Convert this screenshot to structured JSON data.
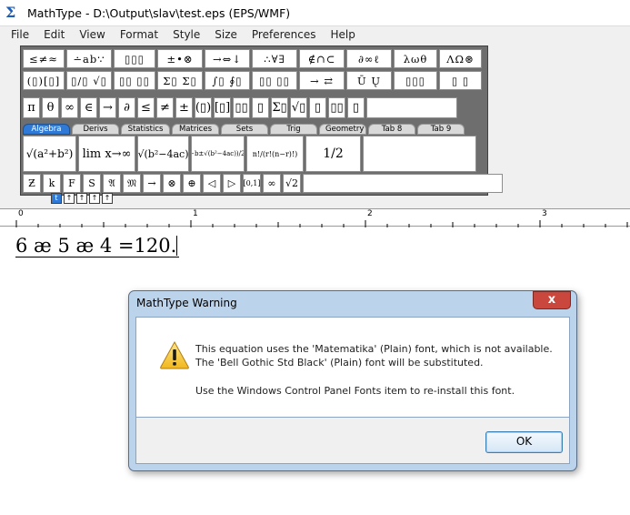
{
  "window": {
    "title": "MathType - D:\\Output\\slav\\test.eps (EPS/WMF)"
  },
  "menu": [
    "File",
    "Edit",
    "View",
    "Format",
    "Style",
    "Size",
    "Preferences",
    "Help"
  ],
  "palette": {
    "row1": [
      "≤≠≈",
      "∸ab∵",
      "▯▯▯",
      "±•⊗",
      "→⇔↓",
      "∴∀∃",
      "∉∩⊂",
      "∂∞ℓ",
      "λωθ",
      "ΛΩ⊛"
    ],
    "row2": [
      "(▯)[▯]",
      "▯/▯ √▯",
      "▯▯ ▯▯",
      "Σ▯ Σ▯",
      "∫▯ ∮▯",
      "▯▯ ▯▯",
      "→ ⇄",
      "Ū Ų",
      "▯▯▯",
      "▯ ▯"
    ],
    "row3": [
      "π",
      "θ",
      "∞",
      "∈",
      "→",
      "∂",
      "≤",
      "≠",
      "±",
      "(▯)",
      "[▯]",
      "▯▯",
      "▯",
      "Σ▯",
      "√▯",
      "▯",
      "▯▯",
      "▯"
    ],
    "tabs": [
      "Algebra",
      "Derivs",
      "Statistics",
      "Matrices",
      "Sets",
      "Trig",
      "Geometry",
      "Tab 8",
      "Tab 9"
    ],
    "active_tab": "Algebra",
    "templates": [
      "√(a²+b²)",
      "lim x→∞",
      "√(b²−4ac)",
      "(−b±√(b²−4ac))/2a",
      "n!/(r!(n−r)!)",
      "1/2"
    ],
    "small_row": [
      "Ƶ",
      "k",
      "F",
      "S",
      "𝔄",
      "𝔐",
      "→",
      "⊗",
      "⊕",
      "◁",
      "▷",
      "[0,1]",
      "∞",
      "√2"
    ],
    "size_buttons": [
      "t",
      "↑",
      "↑",
      "↑",
      "↑"
    ]
  },
  "ruler": [
    "0",
    "1",
    "2",
    "3"
  ],
  "equation": "6 æ 5 æ 4 =120.",
  "dialog": {
    "title": "MathType Warning",
    "message_line1": "This equation uses the 'Matematika' (Plain) font, which is not available.",
    "message_line2": "The 'Bell Gothic Std Black' (Plain) font will be substituted.",
    "message_line3": "Use the Windows Control Panel Fonts item to re-install this font.",
    "ok_label": "OK",
    "close_label": "x"
  },
  "colors": {
    "tab_active": "#2f7ad6",
    "dialog_frame": "#bcd3ec",
    "close_button": "#c9473c"
  }
}
